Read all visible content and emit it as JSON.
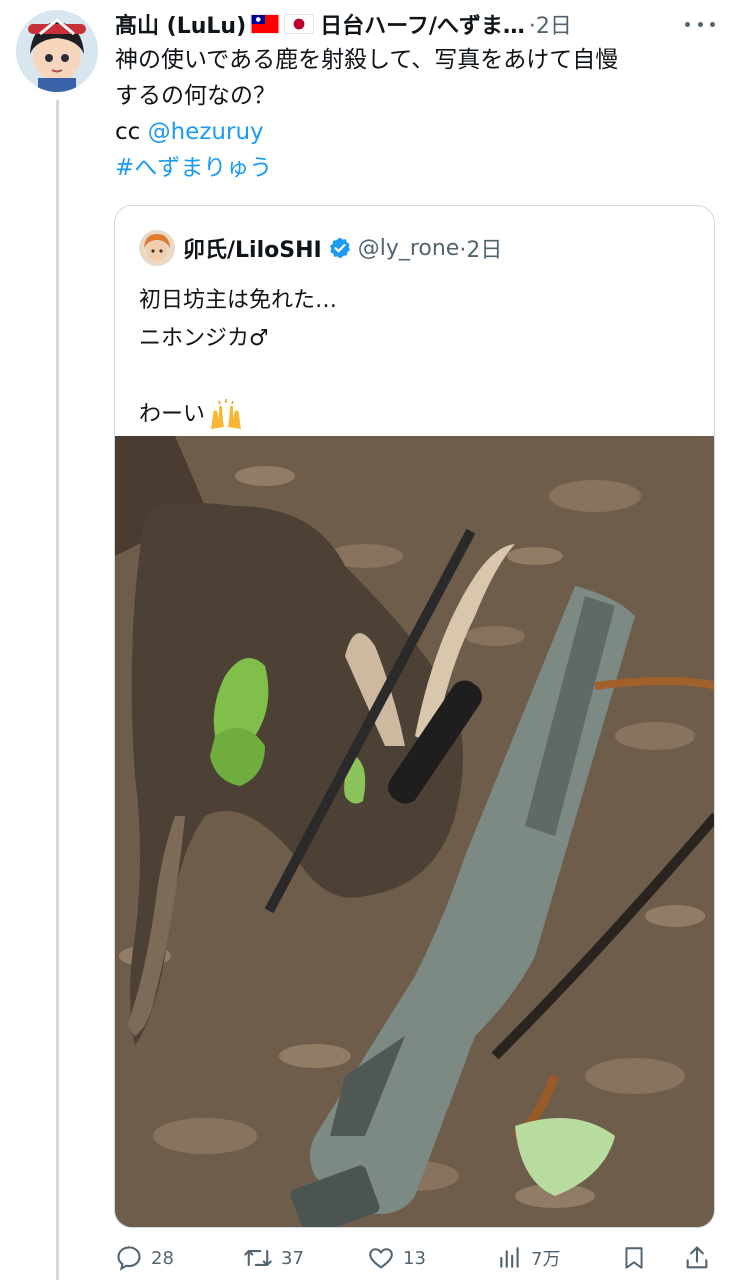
{
  "tweet": {
    "author_name": "髙山 (LuLu)",
    "author_name_tail": "日台ハーフ/へずま…",
    "time": "·2日",
    "text_line1": "神の使いである鹿を射殺して、写真をあけて自慢",
    "text_line2": "するの何なの？",
    "cc_prefix": "cc ",
    "mention": "@hezuruy",
    "hashtag": "#へずまりゅう"
  },
  "quote": {
    "name": "卯氏/LiloSHI",
    "handle": "@ly_rone",
    "time": "·2日",
    "line1": "初日坊主は免れた…",
    "line2": "ニホンジカ♂",
    "line3": "",
    "line4": "わーい"
  },
  "actions": {
    "replies": "28",
    "retweets": "37",
    "likes": "13",
    "views": "7万"
  },
  "icons": {
    "more": "more-icon",
    "verified": "verified-icon",
    "reply": "reply-icon",
    "retweet": "retweet-icon",
    "like": "heart-icon",
    "views": "views-icon",
    "bookmark": "bookmark-icon",
    "share": "share-icon"
  },
  "colors": {
    "accent": "#1d9bf0",
    "muted": "#536471",
    "border": "#cfd9de"
  }
}
